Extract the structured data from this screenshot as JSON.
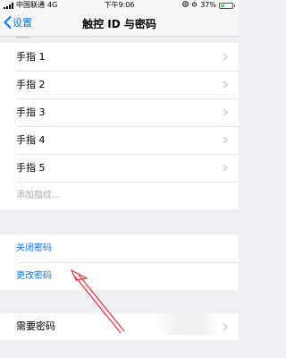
{
  "status": {
    "carrier": "中国联通",
    "network": "4G",
    "time": "下午9:06",
    "battery_text": "37%",
    "battery_level": 0.37
  },
  "nav": {
    "back_label": "设置",
    "title": "触控 ID 与密码"
  },
  "section_fingerprints": {
    "items": [
      "手指 1",
      "手指 2",
      "手指 3",
      "手指 4",
      "手指 5"
    ],
    "add_label": "添加指纹..."
  },
  "section_passcode": {
    "turn_off": "关闭密码",
    "change": "更改密码"
  },
  "section_require": {
    "label": "需要密码"
  },
  "colors": {
    "accent": "#007aff",
    "annotation_arrow": "#e0303a",
    "battery": "#4cd964"
  }
}
